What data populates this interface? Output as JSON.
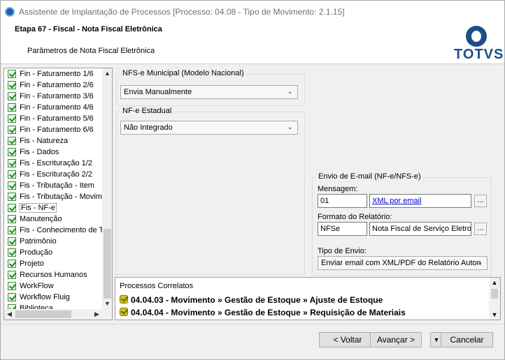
{
  "window": {
    "title": "Assistente de Implantação de Processos [Processo: 04.08 - Tipo de Movimento: 2.1.15]"
  },
  "header": {
    "step": "Etapa 67 - Fiscal - Nota Fiscal Eletrônica",
    "subtitle": "Parâmetros de Nota Fiscal Eletrônica",
    "logo_text": "TOTVS"
  },
  "tree": {
    "items": [
      {
        "label": "Fin - Faturamento 1/6"
      },
      {
        "label": "Fin - Faturamento 2/6"
      },
      {
        "label": "Fin - Faturamento 3/6"
      },
      {
        "label": "Fin - Faturamento 4/6"
      },
      {
        "label": "Fin - Faturamento 5/6"
      },
      {
        "label": "Fin - Faturamento 6/6"
      },
      {
        "label": "Fis - Natureza"
      },
      {
        "label": "Fis - Dados"
      },
      {
        "label": "Fis - Escrituração 1/2"
      },
      {
        "label": "Fis - Escrituração 2/2"
      },
      {
        "label": "Fis - Tributação - Item"
      },
      {
        "label": "Fis - Tributação - Movime"
      },
      {
        "label": "Fis - NF-e",
        "selected": true
      },
      {
        "label": "Manutenção"
      },
      {
        "label": "Fis - Conhecimento de T"
      },
      {
        "label": "Patrimônio"
      },
      {
        "label": "Produção"
      },
      {
        "label": "Projeto"
      },
      {
        "label": "Recursos Humanos"
      },
      {
        "label": "WorkFlow"
      },
      {
        "label": "Workflow Fluig"
      },
      {
        "label": "Biblioteca"
      }
    ]
  },
  "nfse": {
    "group_title": "NFS-e Municipal (Modelo Nacional)",
    "value": "Envia Manualmente"
  },
  "nfe": {
    "group_title": "NF-e Estadual",
    "value": "Não Integrado"
  },
  "email": {
    "group_title": "Envio de E-mail (NF-e/NFS-e)",
    "mensagem_label": "Mensagem:",
    "mensagem_code": "01",
    "mensagem_desc": "XML por email",
    "formato_label": "Formato do Relatório:",
    "formato_code": "NFSe",
    "formato_desc": "Nota Fiscal de Serviço Eletron",
    "tipo_label": "Tipo de Envio:",
    "tipo_value": "Enviar email com XML/PDF do Relatório Auton",
    "dots": "..."
  },
  "correlatos": {
    "title": "Processos Correlatos",
    "items": [
      {
        "label": "04.04.03 - Movimento » Gestão de Estoque » Ajuste de Estoque"
      },
      {
        "label": "04.04.04 - Movimento » Gestão de Estoque » Requisição de Materiais"
      }
    ]
  },
  "buttons": {
    "back": "< Voltar",
    "next": "Avançar >",
    "cancel": "Cancelar"
  },
  "icons": {
    "app": "app-icon",
    "dropdown": "chevron-down-icon"
  }
}
